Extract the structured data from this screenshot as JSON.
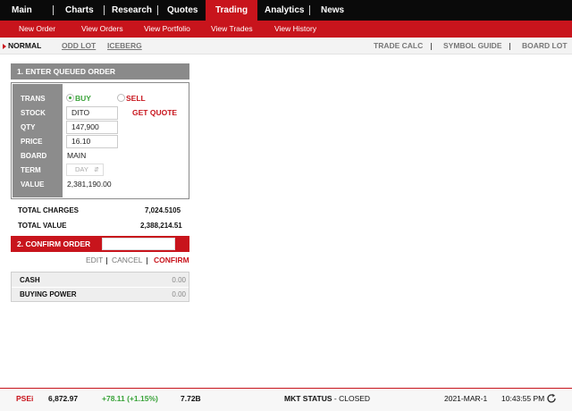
{
  "topnav": {
    "items": [
      {
        "label": "Main"
      },
      {
        "label": "Charts"
      },
      {
        "label": "Research"
      },
      {
        "label": "Quotes"
      },
      {
        "label": "Trading"
      },
      {
        "label": "Analytics"
      },
      {
        "label": "News"
      }
    ],
    "active_index": 4
  },
  "subnav": {
    "items": [
      {
        "label": "New Order"
      },
      {
        "label": "View Orders"
      },
      {
        "label": "View Portfolio"
      },
      {
        "label": "View Trades"
      },
      {
        "label": "View History"
      }
    ],
    "active_index": 0
  },
  "order_types": {
    "normal": "NORMAL",
    "odd_lot": "ODD LOT",
    "iceberg": "ICEBERG",
    "active": "normal"
  },
  "tools": {
    "trade_calc": "TRADE CALC",
    "symbol_guide": "SYMBOL GUIDE",
    "board_lot": "BOARD LOT"
  },
  "entry": {
    "header": "1. ENTER QUEUED ORDER",
    "labels": {
      "trans": "TRANS",
      "stock": "STOCK",
      "qty": "QTY",
      "price": "PRICE",
      "board": "BOARD",
      "term": "TERM",
      "value": "VALUE"
    },
    "buy_label": "BUY",
    "sell_label": "SELL",
    "selected_side": "buy",
    "stock": "DITO",
    "get_quote": "GET QUOTE",
    "qty": "147,900",
    "price": "16.10",
    "board": "MAIN",
    "term": "DAY",
    "value": "2,381,190.00"
  },
  "totals": {
    "charges_label": "TOTAL CHARGES",
    "charges": "7,024.5105",
    "value_label": "TOTAL VALUE",
    "value": "2,388,214.51"
  },
  "confirm": {
    "header": "2. CONFIRM ORDER",
    "edit": "EDIT",
    "cancel": "CANCEL",
    "confirm": "CONFIRM"
  },
  "account": {
    "cash_label": "CASH",
    "cash": "0.00",
    "buying_power_label": "BUYING POWER",
    "buying_power": "0.00"
  },
  "ticker": {
    "index": "PSEi",
    "level": "6,872.97",
    "change": "+78.11 (+1.15%)",
    "volume": "7.72B",
    "mkt_status_label": "MKT STATUS",
    "mkt_status": "CLOSED",
    "date": "2021-MAR-1",
    "time": "10:43:55 PM"
  },
  "colors": {
    "brand_red": "#c8141c",
    "nav_black": "#0a0a0a",
    "positive_green": "#3aa33a",
    "label_gray": "#8c8c8c"
  }
}
